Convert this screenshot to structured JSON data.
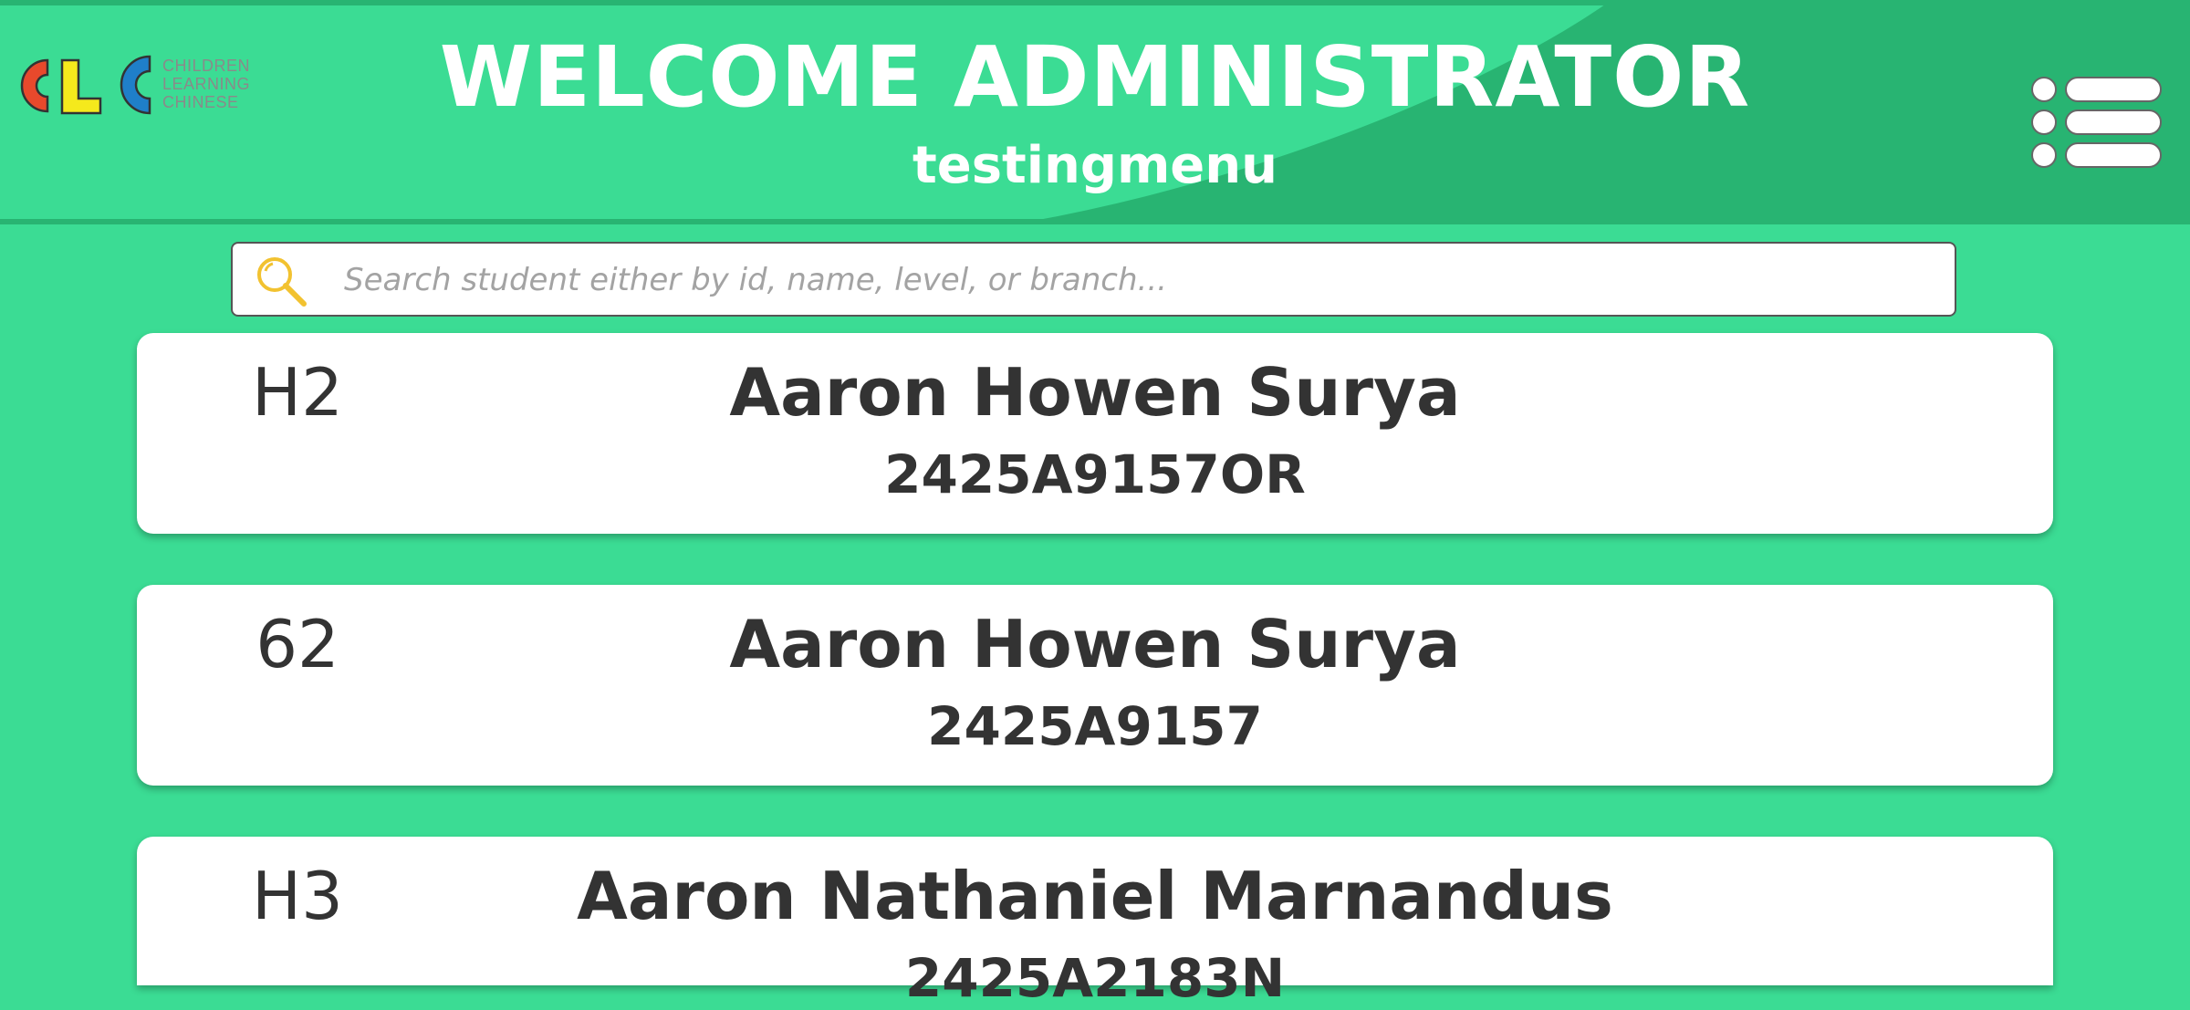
{
  "header": {
    "logo_text": [
      "CHILDREN",
      "LEARNING",
      "CHINESE"
    ],
    "logo_letters": [
      "C",
      "L",
      "C"
    ],
    "title": "WELCOME ADMINISTRATOR",
    "subtitle": "testingmenu",
    "menu_icon": "hamburger-list-icon"
  },
  "search": {
    "icon": "magnifier-icon",
    "placeholder": "Search student either by id, name, level, or branch...",
    "value": ""
  },
  "students": [
    {
      "level": "H2",
      "name": "Aaron Howen Surya",
      "id": "2425A9157OR"
    },
    {
      "level": "62",
      "name": "Aaron Howen Surya",
      "id": "2425A9157"
    },
    {
      "level": "H3",
      "name": "Aaron Nathaniel Marnandus",
      "id": "2425A2183N"
    }
  ],
  "colors": {
    "background": "#3bdc94",
    "header_dark": "#28b472",
    "card": "#ffffff",
    "text": "#333333",
    "logo_red": "#e8492c",
    "logo_yellow": "#f5e91c",
    "logo_blue": "#1f7fc9",
    "search_icon": "#f2c230"
  }
}
